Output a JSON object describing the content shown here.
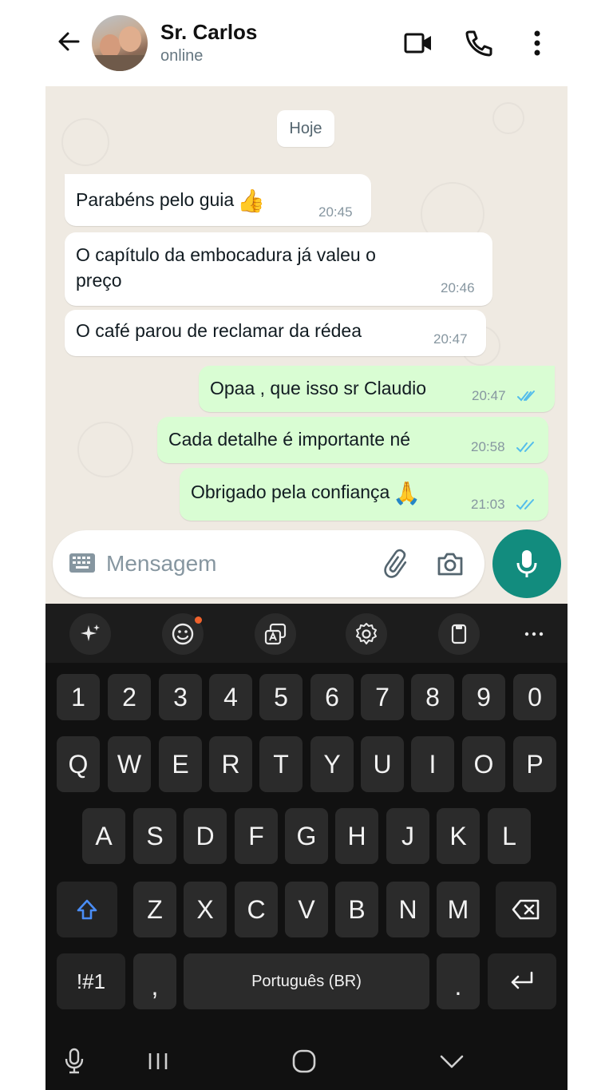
{
  "header": {
    "contact_name": "Sr. Carlos",
    "status": "online"
  },
  "chat": {
    "date_chip": "Hoje",
    "messages": [
      {
        "text": "Parabéns pelo guia",
        "emoji": "👍",
        "time": "20:45",
        "direction": "incoming"
      },
      {
        "line1": "O capítulo da embocadura já valeu o",
        "line2": "preço",
        "time": "20:46",
        "direction": "incoming"
      },
      {
        "text": "O café parou de reclamar da rédea",
        "time": "20:47",
        "direction": "incoming"
      },
      {
        "text": "Opaa , que isso sr Claudio",
        "time": "20:47",
        "direction": "outgoing",
        "status": "read"
      },
      {
        "text": "Cada detalhe é  importante né",
        "time": "20:58",
        "direction": "outgoing",
        "status": "read"
      },
      {
        "text": "Obrigado pela confiança",
        "emoji": "🙏",
        "time": "21:03",
        "direction": "outgoing",
        "status": "read"
      }
    ]
  },
  "composer": {
    "placeholder": "Mensagem"
  },
  "keyboard": {
    "toolbar_icons": [
      "sparkle-icon",
      "emoji-icon",
      "translate-icon",
      "settings-icon",
      "clipboard-icon",
      "more-icon"
    ],
    "number_row": [
      "1",
      "2",
      "3",
      "4",
      "5",
      "6",
      "7",
      "8",
      "9",
      "0"
    ],
    "row1": [
      "Q",
      "W",
      "E",
      "R",
      "T",
      "Y",
      "U",
      "I",
      "O",
      "P"
    ],
    "row2": [
      "A",
      "S",
      "D",
      "F",
      "G",
      "H",
      "J",
      "K",
      "L"
    ],
    "row3": [
      "Z",
      "X",
      "C",
      "V",
      "B",
      "N",
      "M"
    ],
    "symbols_key": "!#1",
    "comma_key": ",",
    "space_label": "Português (BR)",
    "period_key": "."
  },
  "colors": {
    "chat_bg": "#efeae2",
    "outgoing_bubble": "#d9fdd3",
    "incoming_bubble": "#ffffff",
    "mic_button": "#128c7e",
    "read_ticks": "#53bdeb",
    "keyboard_bg": "#111111"
  }
}
